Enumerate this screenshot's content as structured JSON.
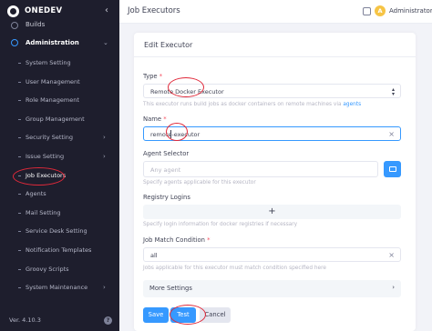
{
  "app": {
    "brand": "ONEDEV",
    "version": "Ver. 4.10.3"
  },
  "sidebar": {
    "top_item": "Builds",
    "section": "Administration",
    "items": [
      "System Setting",
      "User Management",
      "Role Management",
      "Group Management",
      "Security Setting",
      "Issue Setting",
      "Job Executors",
      "Agents",
      "Mail Setting",
      "Service Desk Setting",
      "Notification Templates",
      "Groovy Scripts",
      "System Maintenance"
    ],
    "selected": "Job Executors"
  },
  "topbar": {
    "title": "Job Executors",
    "avatar_initial": "A",
    "user": "Administrator"
  },
  "form": {
    "title": "Edit Executor",
    "type": {
      "label": "Type",
      "value": "Remote Docker Executor",
      "help_prefix": "This executor runs build jobs as docker containers on remote machines via",
      "help_link": "agents"
    },
    "name": {
      "label": "Name",
      "value": "remote-executor"
    },
    "agent_selector": {
      "label": "Agent Selector",
      "placeholder": "Any agent",
      "help": "Specify agents applicable for this executor"
    },
    "registry_logins": {
      "label": "Registry Logins",
      "add": "+",
      "help": "Specify login information for docker registries if necessary"
    },
    "job_match": {
      "label": "Job Match Condition",
      "value": "all",
      "help": "Jobs applicable for this executor must match condition specified here"
    },
    "more_settings": "More Settings",
    "buttons": {
      "save": "Save",
      "test": "Test",
      "cancel": "Cancel"
    },
    "required_mark": "*"
  },
  "colors": {
    "accent": "#3699ff",
    "sidebar_bg": "#1e1e2d",
    "annotation": "#e0293a"
  }
}
